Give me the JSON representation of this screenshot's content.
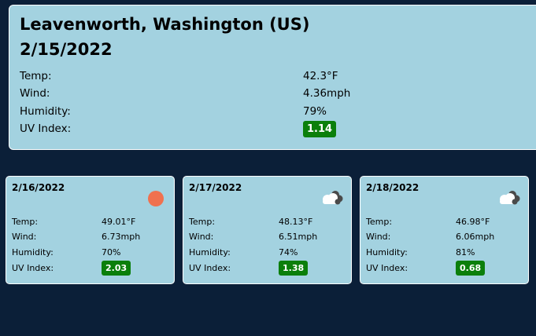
{
  "current": {
    "city": "Leavenworth, Washington (US)",
    "date": "2/15/2022",
    "labels": {
      "temp": "Temp:",
      "wind": "Wind:",
      "humidity": "Humidity:",
      "uv": "UV Index:"
    },
    "temp": "42.3°F",
    "wind": "4.36mph",
    "humidity": "79%",
    "uv": "1.14"
  },
  "forecast": [
    {
      "date": "2/16/2022",
      "icon": "sun-icon",
      "temp": "49.01°F",
      "wind": "6.73mph",
      "humidity": "70%",
      "uv": "2.03"
    },
    {
      "date": "2/17/2022",
      "icon": "cloudy-icon",
      "temp": "48.13°F",
      "wind": "6.51mph",
      "humidity": "74%",
      "uv": "1.38"
    },
    {
      "date": "2/18/2022",
      "icon": "cloudy-icon",
      "temp": "46.98°F",
      "wind": "6.06mph",
      "humidity": "81%",
      "uv": "0.68"
    }
  ],
  "colors": {
    "background": "#0b1f38",
    "panel": "#a3d2e0",
    "uv_low": "#0b7f0b",
    "sun": "#f0714f"
  }
}
